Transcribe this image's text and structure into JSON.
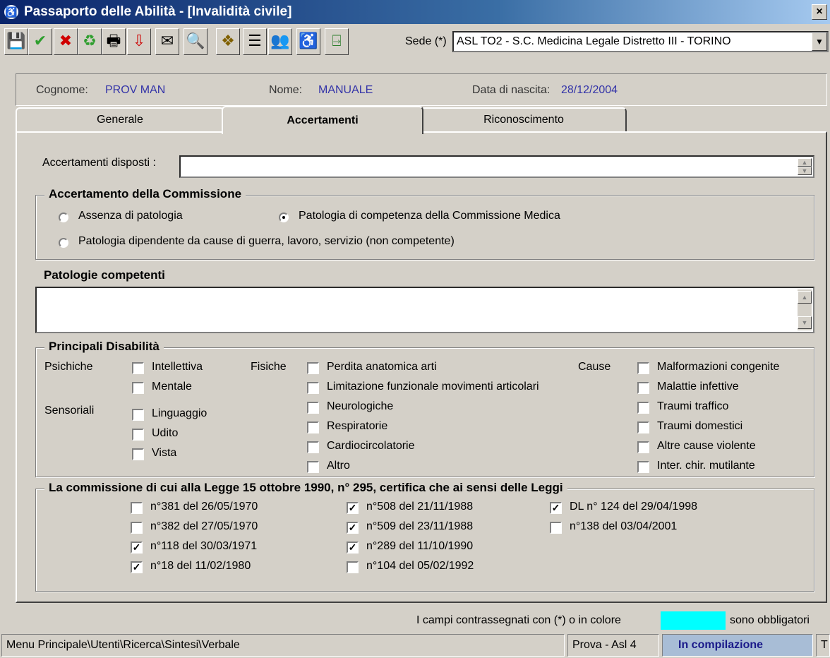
{
  "window": {
    "title": "Passaporto delle Abilità - [Invalidità civile]",
    "close": "×"
  },
  "toolbar": {
    "buttons": [
      {
        "name": "save-button",
        "glyph": "💾",
        "color": "#000"
      },
      {
        "name": "confirm-button",
        "glyph": "✔",
        "color": "#2e9e2e"
      },
      {
        "name": "cancel-button",
        "glyph": "✖",
        "color": "#d00000"
      },
      {
        "name": "refresh-button",
        "glyph": "♻",
        "color": "#2e9e2e"
      },
      {
        "name": "print-button",
        "glyph": "🖶",
        "color": "#000"
      },
      {
        "name": "export-button",
        "glyph": "⇩",
        "color": "#c00"
      },
      {
        "name": "mail-button",
        "glyph": "✉",
        "color": "#000"
      },
      {
        "name": "search-button",
        "glyph": "🔍",
        "color": "#000"
      },
      {
        "name": "stamp-button",
        "glyph": "❖",
        "color": "#806000"
      },
      {
        "name": "document-button",
        "glyph": "☰",
        "color": "#000"
      },
      {
        "name": "people-button",
        "glyph": "👥",
        "color": "#c00"
      },
      {
        "name": "accessibility-button",
        "glyph": "♿",
        "color": "#0050a0"
      },
      {
        "name": "exit-button",
        "glyph": "⍈",
        "color": "#2e7e2e"
      }
    ],
    "sede_label": "Sede (*)",
    "sede_value": "ASL TO2 - S.C. Medicina Legale Distretto III - TORINO"
  },
  "header": {
    "cognome_label": "Cognome:",
    "cognome": "PROV MAN",
    "nome_label": "Nome:",
    "nome": "MANUALE",
    "nascita_label": "Data di nascita:",
    "nascita": "28/12/2004"
  },
  "tabs": [
    "Generale",
    "Accertamenti",
    "Riconoscimento"
  ],
  "accertamenti": {
    "disposti_label": "Accertamenti disposti :",
    "commissione_title": "Accertamento della Commissione",
    "radio": [
      "Assenza di patologia",
      "Patologia di competenza della Commissione Medica",
      "Patologia dipendente da cause di guerra, lavoro, servizio (non competente)"
    ],
    "patologie_title": "Patologie competenti"
  },
  "disabilita": {
    "title": "Principali Disabilità",
    "psichiche_label": "Psichiche",
    "sensoriali_label": "Sensoriali",
    "fisiche_label": "Fisiche",
    "cause_label": "Cause",
    "psichiche": [
      "Intellettiva",
      "Mentale"
    ],
    "sensoriali": [
      "Linguaggio",
      "Udito",
      "Vista"
    ],
    "fisiche": [
      "Perdita anatomica arti",
      "Limitazione funzionale movimenti articolari",
      "Neurologiche",
      "Respiratorie",
      "Cardiocircolatorie",
      "Altro"
    ],
    "cause": [
      "Malformazioni congenite",
      "Malattie infettive",
      "Traumi traffico",
      "Traumi domestici",
      "Altre cause violente",
      "Inter. chir. mutilante"
    ]
  },
  "leggi": {
    "title": "La commissione di cui alla Legge 15 ottobre 1990, n° 295, certifica che ai sensi delle Leggi",
    "col1": [
      {
        "label": "n°381 del 26/05/1970",
        "checked": false
      },
      {
        "label": "n°382 del 27/05/1970",
        "checked": false
      },
      {
        "label": "n°118 del 30/03/1971",
        "checked": true
      },
      {
        "label": "n°18   del 11/02/1980",
        "checked": true
      }
    ],
    "col2": [
      {
        "label": "n°508 del 21/11/1988",
        "checked": true
      },
      {
        "label": "n°509 del 23/11/1988",
        "checked": true
      },
      {
        "label": "n°289 del 11/10/1990",
        "checked": true
      },
      {
        "label": "n°104 del 05/02/1992",
        "checked": false
      }
    ],
    "col3": [
      {
        "label": "DL n° 124 del 29/04/1998",
        "checked": true
      },
      {
        "label": "n°138 del 03/04/2001",
        "checked": false
      }
    ]
  },
  "required_note": {
    "prefix": "I campi contrassegnati con (*) o in colore",
    "suffix": "sono obbligatori",
    "color": "#00ffff"
  },
  "statusbar": {
    "path": "Menu Principale\\Utenti\\Ricerca\\Sintesi\\Verbale",
    "env": "Prova - Asl 4",
    "state": "In compilazione",
    "extra": "T"
  }
}
